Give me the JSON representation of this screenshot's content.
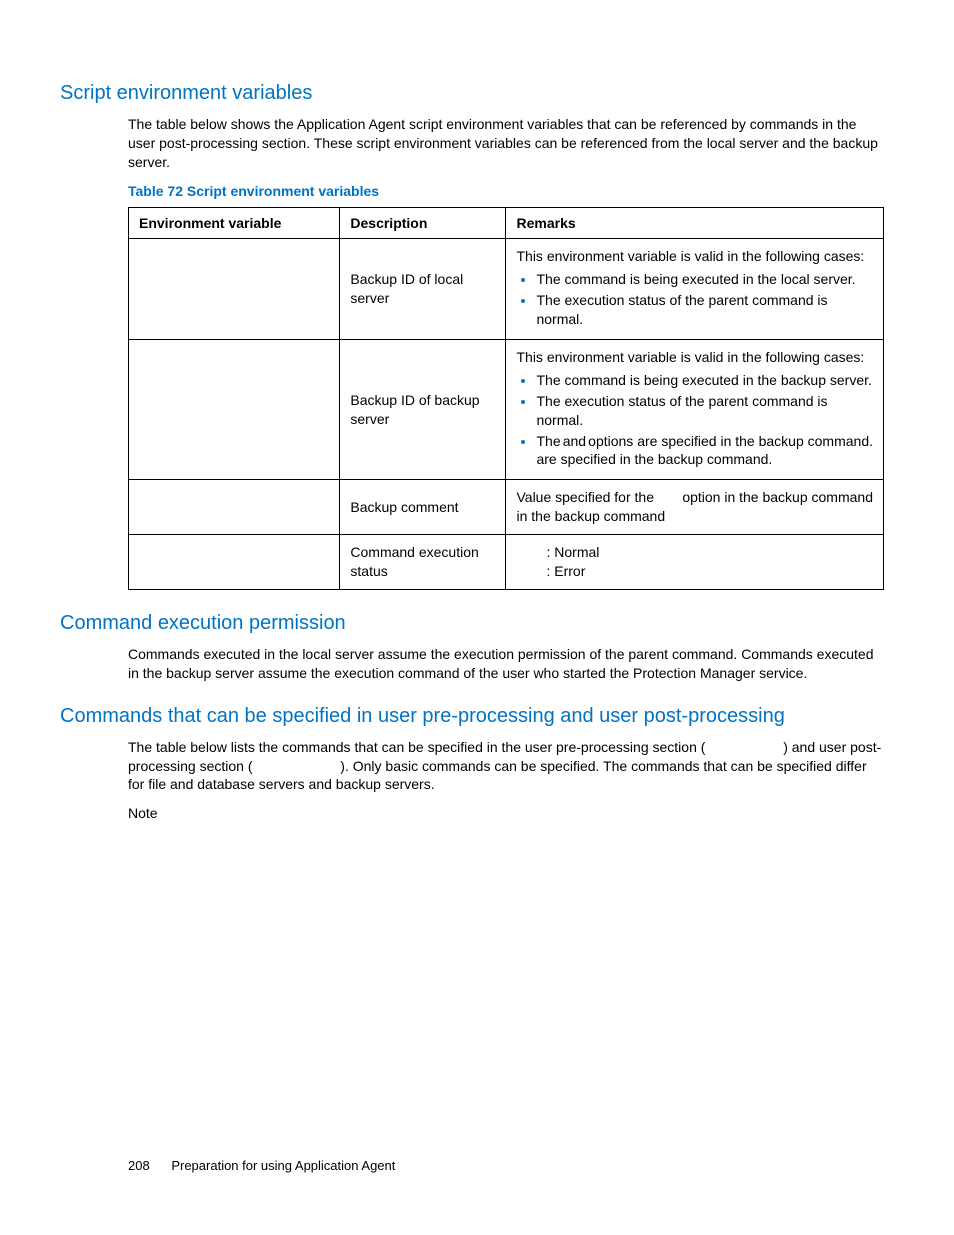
{
  "section1": {
    "heading": "Script environment variables",
    "body": "The table below shows the Application Agent script environment variables that can be referenced by commands in the user post-processing section. These script environment variables can be referenced from the local server and the backup server.",
    "table_caption": "Table 72 Script environment variables",
    "headers": {
      "c1": "Environment variable",
      "c2": "Description",
      "c3": "Remarks"
    },
    "rows": {
      "r1": {
        "desc": "Backup ID of local server",
        "rem_intro": "This environment variable is valid in the following cases:",
        "b1": "The command is being executed in the local server.",
        "b2": "The execution status of the parent command is normal."
      },
      "r2": {
        "desc": "Backup ID of backup server",
        "rem_intro": "This environment variable is valid in the following cases:",
        "b1": "The command is being executed in the backup server.",
        "b2": "The execution status of the parent command is normal.",
        "b3_pre": "The",
        "b3_mid": "and",
        "b3_post": "options are specified in the backup command."
      },
      "r3": {
        "desc": "Backup comment",
        "rem_pre": "Value specified for the",
        "rem_post": "option in the backup command"
      },
      "r4": {
        "desc": "Command execution status",
        "line1": ": Normal",
        "line2": ": Error"
      }
    }
  },
  "section2": {
    "heading": "Command execution permission",
    "body": "Commands executed in the local server assume the execution permission of the parent command. Commands executed in the backup server assume the execution command of the user who started the Protection Manager service."
  },
  "section3": {
    "heading": "Commands that can be specified in user pre-processing and user post-processing",
    "body_p1": "The table below lists the commands that can be specified in the user pre-processing section (",
    "body_p2": ") and user post-processing section (",
    "body_p3": "). Only basic commands can be specified. The commands that can be specified differ for file and database servers and backup servers.",
    "note": "Note"
  },
  "footer": {
    "page": "208",
    "title": "Preparation for using Application Agent"
  }
}
